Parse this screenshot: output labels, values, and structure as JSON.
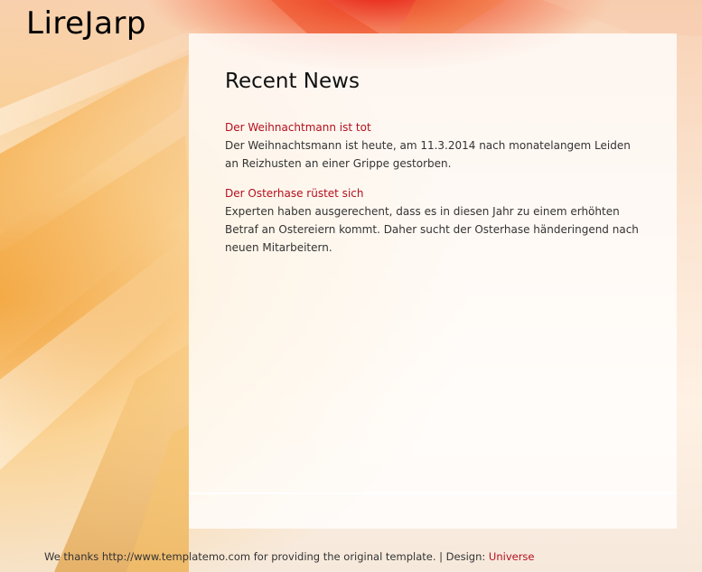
{
  "site": {
    "title": "LireJarp"
  },
  "main": {
    "heading": "Recent News",
    "news": [
      {
        "title": "Der Weihnachtmann ist tot",
        "text": "Der Weihnachtsmann ist heute, am 11.3.2014 nach monatelangem Leiden an Reizhusten an einer Grippe gestorben."
      },
      {
        "title": "Der Osterhase rüstet sich",
        "text": "Experten haben ausgerechent, dass es in diesen Jahr zu einem erhöhten Betraf an Ostereiern kommt. Daher sucht der Osterhase händeringend nach neuen Mitarbeitern."
      }
    ]
  },
  "footer": {
    "text": "We thanks http://www.templatemo.com for providing the original template. | Design: ",
    "design_link": "Universe"
  },
  "colors": {
    "link": "#b40f1e",
    "heading": "#111111",
    "body_text": "#333333"
  }
}
